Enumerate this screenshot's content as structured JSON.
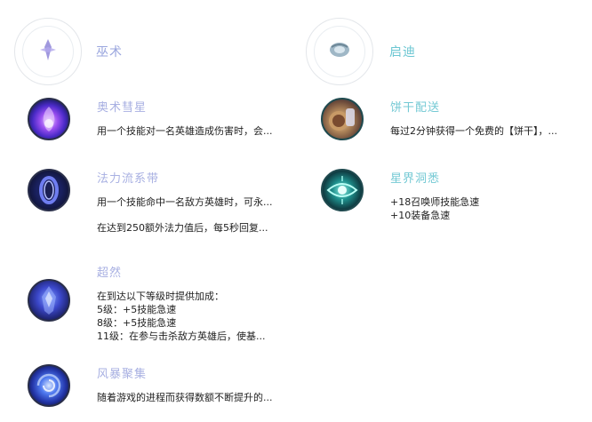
{
  "colors": {
    "sorcery_title": "#9aa6de",
    "inspiration_title": "#6bc6d2",
    "sorcery_rune_name": "#a8b0e2",
    "inspiration_rune_name": "#74c9d4",
    "body_text": "#222222"
  },
  "primary_tree": {
    "title": "巫术",
    "icon": "sorcery-icon",
    "runes": [
      {
        "name": "奥术彗星",
        "icon": "arcane-comet-icon",
        "lines": [
          "用一个技能对一名英雄造成伤害时，会..."
        ]
      },
      {
        "name": "法力流系带",
        "icon": "manaflow-band-icon",
        "lines": [
          "用一个技能命中一名敌方英雄时，可永...",
          "",
          "在达到250额外法力值后，每5秒回复..."
        ]
      },
      {
        "name": "超然",
        "icon": "transcendence-icon",
        "lines": [
          "在到达以下等级时提供加成：",
          "5级：+5技能急速",
          "8级：+5技能急速",
          "11级：在参与击杀敌方英雄后，使基..."
        ]
      },
      {
        "name": "风暴聚集",
        "icon": "gathering-storm-icon",
        "lines": [
          "随着游戏的进程而获得数额不断提升的..."
        ]
      }
    ]
  },
  "secondary_tree": {
    "title": "启迪",
    "icon": "inspiration-icon",
    "runes": [
      {
        "name": "饼干配送",
        "icon": "biscuit-delivery-icon",
        "lines": [
          "每过2分钟获得一个免费的【饼干】，..."
        ]
      },
      {
        "name": "星界洞悉",
        "icon": "cosmic-insight-icon",
        "lines": [
          "+18召唤师技能急速",
          "+10装备急速"
        ]
      }
    ]
  }
}
